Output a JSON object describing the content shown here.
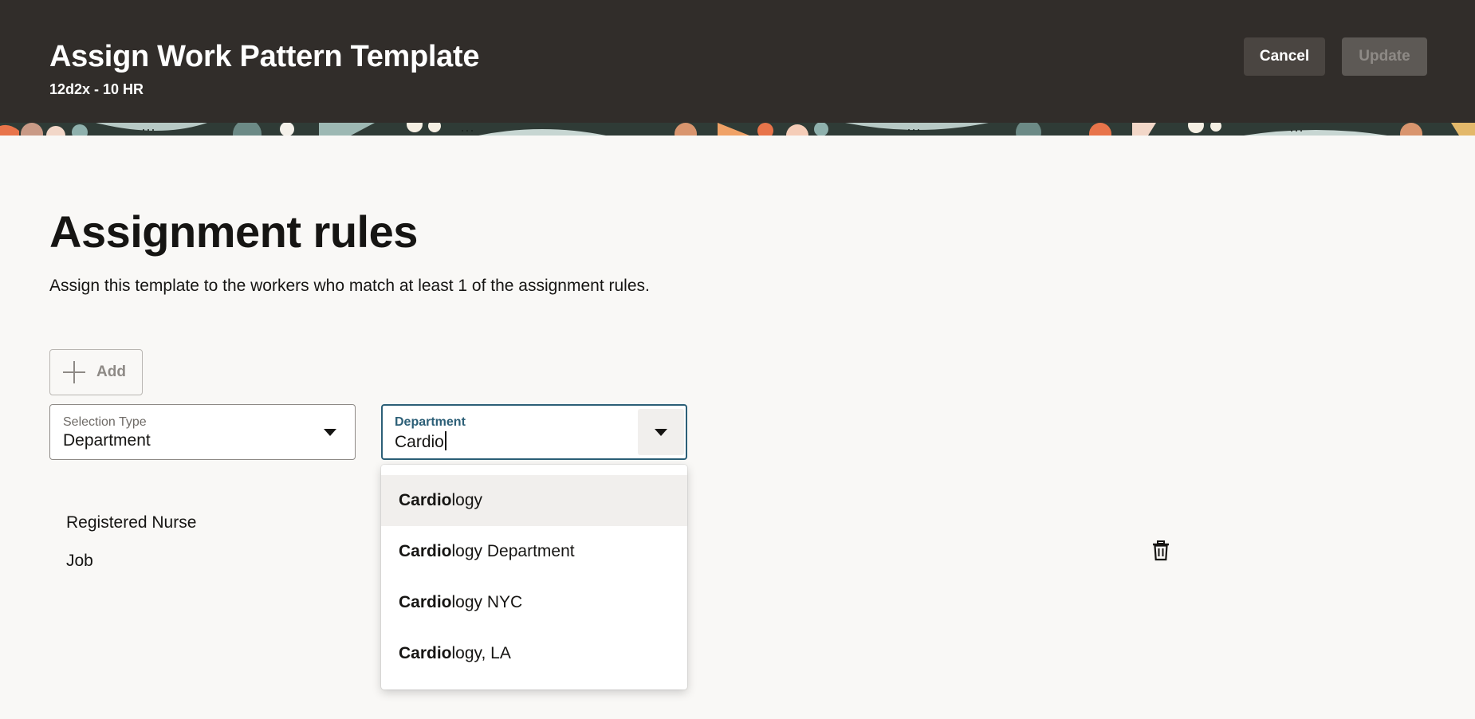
{
  "header": {
    "title": "Assign Work Pattern Template",
    "subtitle": "12d2x - 10 HR",
    "cancel_label": "Cancel",
    "update_label": "Update"
  },
  "main": {
    "heading": "Assignment rules",
    "description": "Assign this template to the workers who match at least 1 of the assignment rules.",
    "add_label": "Add"
  },
  "selection_type": {
    "label": "Selection Type",
    "value": "Department"
  },
  "department": {
    "label": "Department",
    "value": "Cardio"
  },
  "suggestions": [
    {
      "match": "Cardio",
      "rest": "logy"
    },
    {
      "match": "Cardio",
      "rest": "logy Department"
    },
    {
      "match": "Cardio",
      "rest": "logy NYC"
    },
    {
      "match": "Cardio",
      "rest": "logy, LA"
    }
  ],
  "rule": {
    "title": "Registered Nurse",
    "type": "Job"
  },
  "icons": {
    "add": "plus-icon",
    "dropdown": "chevron-down-icon",
    "delete": "trash-icon"
  },
  "colors": {
    "header_bg": "#312d2a",
    "focus_border": "#2c5f77",
    "page_bg": "#f9f8f6"
  }
}
